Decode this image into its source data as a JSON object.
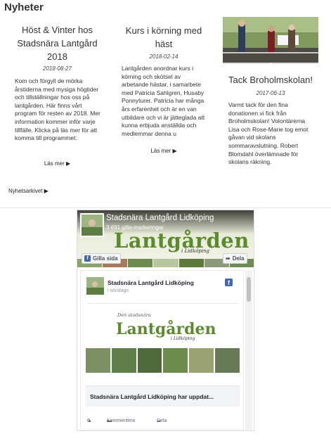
{
  "news": {
    "title": "Nyheter",
    "articles": [
      {
        "title": "Höst & Vinter hos Stadsnära Lantgård 2018",
        "date": "2018-08-27",
        "body": "Kom och förgyll de mörka årstiderna med mysiga högtider och tillställningar hos oss på lantgården. Här finns vårt program för resten av 2018. Mer information kommer inför varje tillfälle. Klicka på läs mer för att komma till programmet.",
        "more": "Läs mer ▶"
      },
      {
        "title": "Kurs i körning med häst",
        "date": "2018-02-14",
        "body": "Lantgården anordnar kurs i körning och skötsel av arbetande hästar, i samarbete med Patricia Sahlgren, Husaby Ponnyturer. Patricia har många års erfarenhet och är en van utbildare och vi är jätteglada att kunna erbjuda anställda och medlemmar denna u",
        "more": "Läs mer ▶"
      },
      {
        "title": "Tack Broholmskolan!",
        "date": "2017-06-13",
        "body": "Varmt tack för den fina donationen vi fick från Broholmskolan! Volontärerna Lisa och Rose-Marie tog emot gåvan vid skolans sommaravslutning. Robert Blomdahl överlämnade för skolans räkning."
      }
    ],
    "archive_label": "Nyhetsarkivet ▶"
  },
  "facebook": {
    "page_name": "Stadsnära Lantgård Lidköping",
    "likes": "3 691 gilla-markeringar",
    "cover_logo": "Lantgården",
    "cover_logo_sub": "i Lidköping",
    "like_button": "Gilla sida",
    "share_button": "Dela",
    "post": {
      "author": "Stadsnära Lantgård Lidköping",
      "time": "i söndags",
      "logo_top": "Den stadsnära",
      "logo_text": "Lantgården",
      "logo_sub": "i Lidköping",
      "link_title": "Stadsnära Lantgård Lidköping har uppdat...",
      "like_count": "6",
      "comment_label": "Kommentera",
      "share_label": "Dela"
    },
    "colors": {
      "fb_blue": "#4267b2",
      "logo_green": "#5c8a2e"
    }
  }
}
